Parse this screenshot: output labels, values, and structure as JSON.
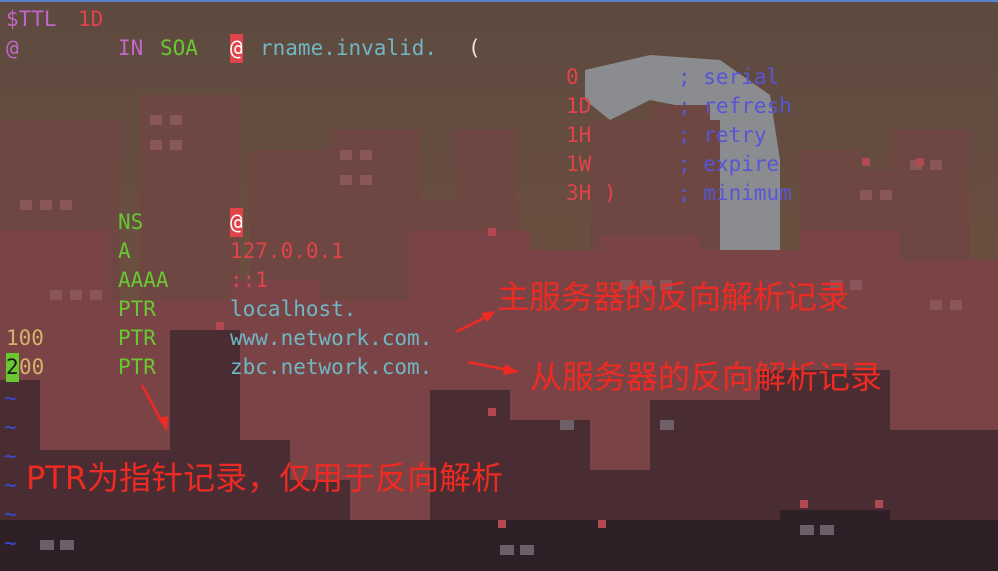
{
  "zone": {
    "line1": {
      "directive": "$TTL",
      "value": "1D"
    },
    "line2": {
      "origin": "@",
      "class": "IN",
      "type": "SOA",
      "mname": "@",
      "rname": "rname.invalid.",
      "paren": "("
    },
    "soa_fields": [
      {
        "value": "0",
        "comment": "; serial"
      },
      {
        "value": "1D",
        "comment": "; refresh"
      },
      {
        "value": "1H",
        "comment": "; retry"
      },
      {
        "value": "1W",
        "comment": "; expire"
      },
      {
        "value": "3H )",
        "comment": "; minimum"
      }
    ],
    "records": [
      {
        "name": "",
        "type": "NS",
        "data": "@"
      },
      {
        "name": "",
        "type": "A",
        "data": "127.0.0.1"
      },
      {
        "name": "",
        "type": "AAAA",
        "data": "::1"
      },
      {
        "name": "",
        "type": "PTR",
        "data": "localhost."
      },
      {
        "name": "100",
        "type": "PTR",
        "data": "www.network.com."
      },
      {
        "name_cursor": "2",
        "name_rest": "00",
        "type": "PTR",
        "data": "zbc.network.com."
      }
    ],
    "tilde": "~"
  },
  "annotations": {
    "primary": "主服务器的反向解析记录",
    "secondary": "从服务器的反向解析记录",
    "ptr_note": "PTR为指针记录，仅用于反向解析"
  },
  "colors": {
    "accent_red": "#ee2a22",
    "keyword_green": "#68c832",
    "comment_blue": "#5656d6",
    "sky": "#6a4e3f",
    "city": "#7a4446"
  }
}
